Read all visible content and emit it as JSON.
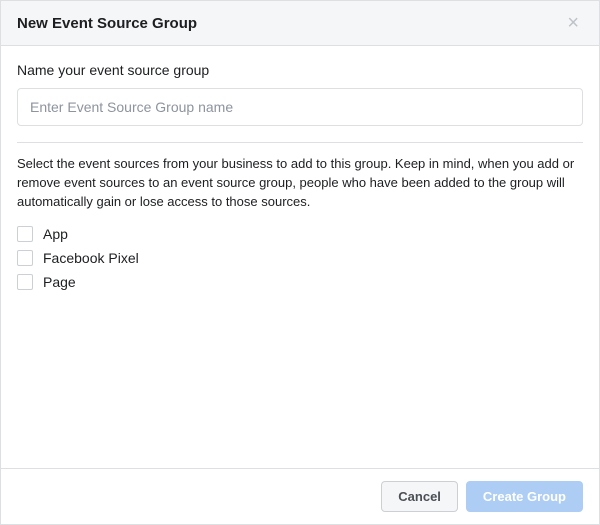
{
  "header": {
    "title": "New Event Source Group"
  },
  "form": {
    "name_label": "Name your event source group",
    "name_placeholder": "Enter Event Source Group name",
    "description": "Select the event sources from your business to add to this group. Keep in mind, when you add or remove event sources to an event source group, people who have been added to the group will automatically gain or lose access to those sources.",
    "options": [
      {
        "label": "App"
      },
      {
        "label": "Facebook Pixel"
      },
      {
        "label": "Page"
      }
    ]
  },
  "footer": {
    "cancel_label": "Cancel",
    "create_label": "Create Group"
  }
}
